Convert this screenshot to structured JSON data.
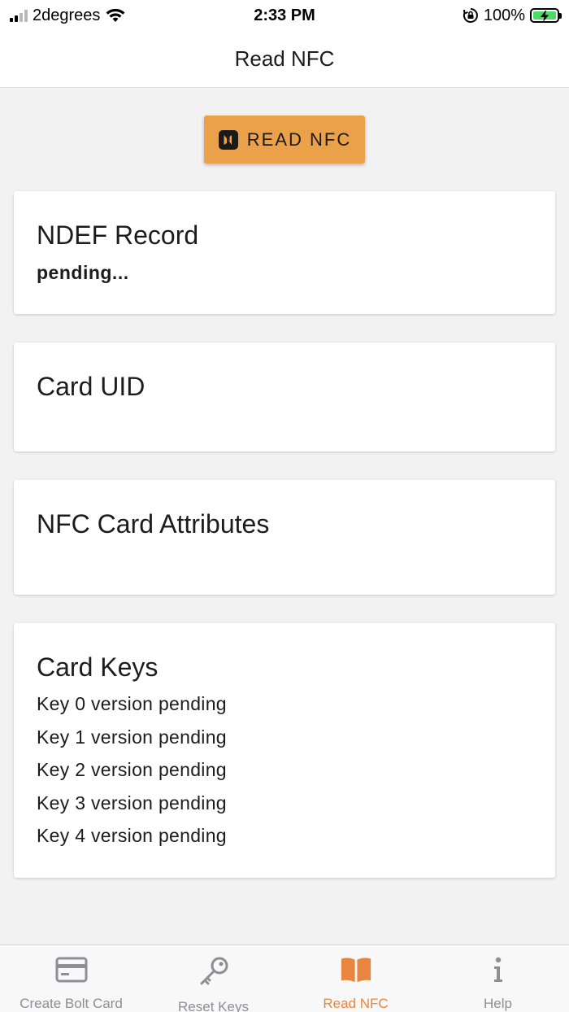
{
  "status_bar": {
    "carrier": "2degrees",
    "time": "2:33 PM",
    "battery_percent": "100%",
    "signal_bars_on": 2,
    "signal_bars_total": 4
  },
  "header": {
    "title": "Read NFC"
  },
  "read_button": {
    "label": "READ NFC",
    "icon": "nfc-icon",
    "color": "#eba04a"
  },
  "cards": {
    "ndef": {
      "title": "NDEF Record",
      "status": "pending..."
    },
    "uid": {
      "title": "Card UID"
    },
    "attributes": {
      "title": "NFC Card Attributes"
    },
    "keys": {
      "title": "Card Keys",
      "items": [
        "Key 0 version pending",
        "Key 1 version pending",
        "Key 2 version pending",
        "Key 3 version pending",
        "Key 4 version pending"
      ]
    }
  },
  "tabs": [
    {
      "label": "Create Bolt Card",
      "icon": "credit-card-icon",
      "active": false
    },
    {
      "label": "Reset Keys",
      "icon": "key-icon",
      "active": false
    },
    {
      "label": "Read NFC",
      "icon": "book-icon",
      "active": true
    },
    {
      "label": "Help",
      "icon": "info-icon",
      "active": false
    }
  ],
  "colors": {
    "accent": "#e8863f",
    "inactive": "#8e8e93"
  }
}
